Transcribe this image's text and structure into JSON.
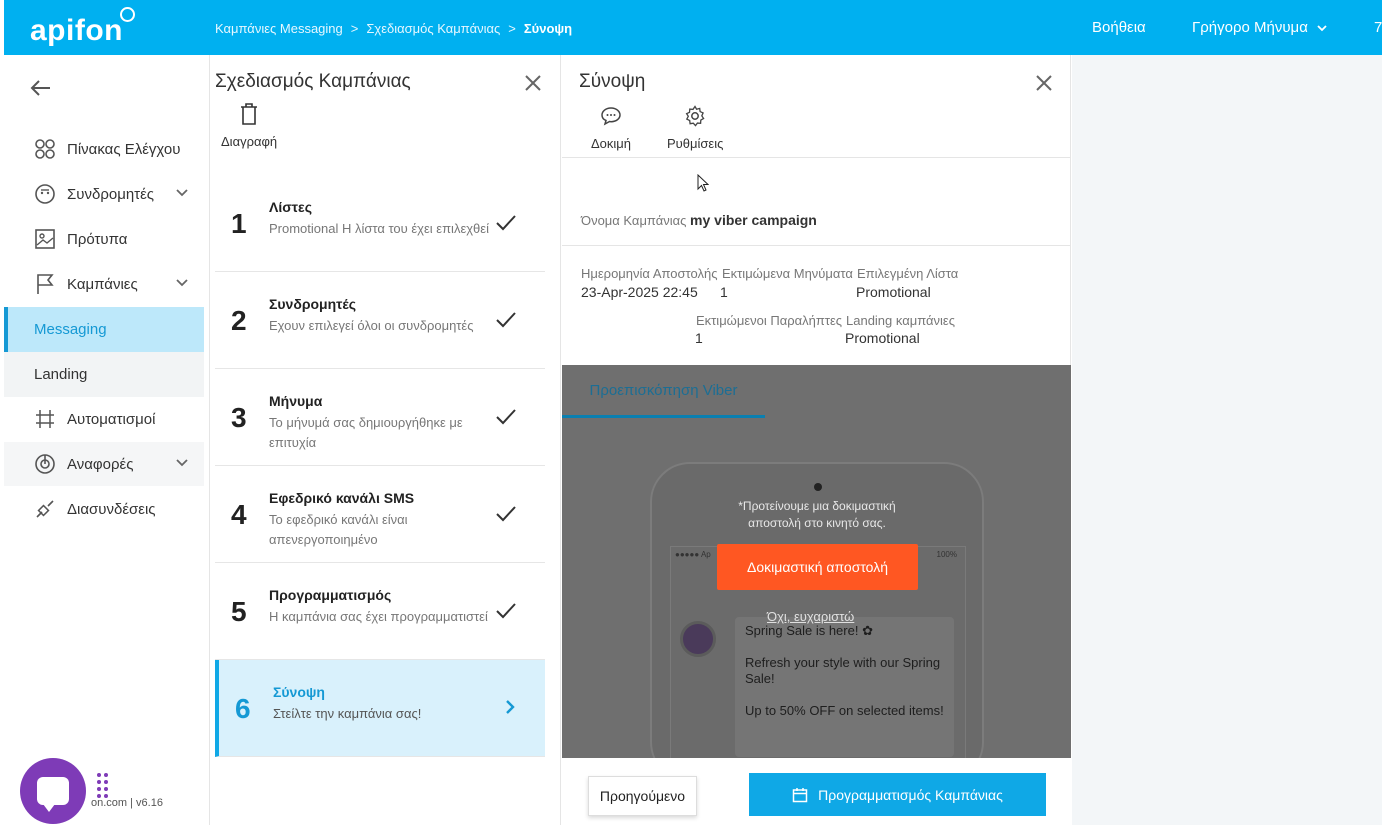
{
  "header": {
    "logo": "apifon",
    "breadcrumbs": [
      "Καμπάνιες Messaging",
      ">",
      "Σχεδιασμός Καμπάνιας",
      ">",
      "Σύνοψη"
    ],
    "help": "Βοήθεια",
    "quick_message": "Γρήγορο Μήνυμα",
    "extra": "7"
  },
  "sidebar": {
    "items": [
      {
        "label": "Πίνακας Ελέγχου",
        "icon": "dashboard-icon"
      },
      {
        "label": "Συνδρομητές",
        "icon": "subscribers-icon"
      },
      {
        "label": "Πρότυπα",
        "icon": "templates-icon"
      },
      {
        "label": "Καμπάνιες",
        "icon": "flag-icon"
      },
      {
        "label": "Messaging"
      },
      {
        "label": "Landing"
      },
      {
        "label": "Αυτοματισμοί",
        "icon": "automation-icon"
      },
      {
        "label": "Αναφορές",
        "icon": "reports-icon"
      },
      {
        "label": "Διασυνδέσεις",
        "icon": "integrations-icon"
      }
    ],
    "version": "on.com | v6.16"
  },
  "planner": {
    "title": "Σχεδιασμός Καμπάνιας",
    "delete_label": "Διαγραφή",
    "steps": [
      {
        "num": "1",
        "title": "Λίστες",
        "desc": "Promotional Η λίστα του έχει επιλεχθεί"
      },
      {
        "num": "2",
        "title": "Συνδρομητές",
        "desc": "Εχουν επιλεγεί όλοι οι συνδρομητές"
      },
      {
        "num": "3",
        "title": "Μήνυμα",
        "desc": "Το μήνυμά σας δημιουργήθηκε με επιτυχία"
      },
      {
        "num": "4",
        "title": "Εφεδρικό κανάλι SMS",
        "desc": "Το εφεδρικό κανάλι είναι απενεργοποιημένο"
      },
      {
        "num": "5",
        "title": "Προγραμματισμός",
        "desc": "Η καμπάνια σας έχει προγραμματιστεί"
      },
      {
        "num": "6",
        "title": "Σύνοψη",
        "desc": "Στείλτε την καμπάνια σας!"
      }
    ]
  },
  "summary": {
    "title": "Σύνοψη",
    "test_label": "Δοκιμή",
    "settings_label": "Ρυθμίσεις",
    "campaign_name_label": "Όνομα Καμπάνιας",
    "campaign_name": "my viber campaign",
    "send_date_label": "Ημερομηνία Αποστολής",
    "send_date": "23-Apr-2025 22:45",
    "est_messages_label": "Εκτιμώμενα Μηνύματα",
    "est_messages": "1",
    "selected_list_label": "Επιλεγμένη Λίστα",
    "selected_list": "Promotional",
    "est_recipients_label": "Εκτιμώμενοι Παραλήπτες",
    "est_recipients": "1",
    "landing_label": "Landing καμπάνιες",
    "landing_value": "Promotional",
    "preview_tab": "Προεπισκόπηση Viber",
    "phone_status_left": "●●●●● Ap",
    "phone_status_right": "100%",
    "msg_line1": "Spring Sale is here! ✿",
    "msg_line2": "Refresh your style with our Spring Sale!",
    "msg_line3": "Up to 50% OFF on selected items!",
    "overlay_text": "*Προτείνουμε μια δοκιμαστική αποστολή στο κινητό σας.",
    "test_send_button": "Δοκιμαστική αποστολή",
    "no_thanks": "Όχι, ευχαριστώ",
    "prev_button": "Προηγούμενο",
    "schedule_button": "Προγραμματισμός Καμπάνιας"
  }
}
